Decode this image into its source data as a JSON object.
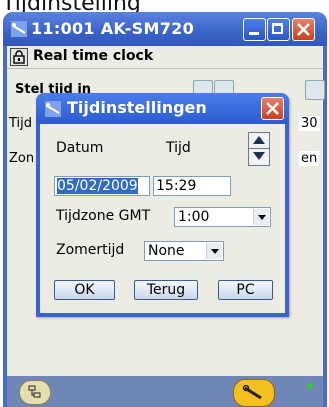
{
  "caption": "Tijdinstelling",
  "main_window": {
    "title": "11:001 AK-SM720",
    "section_title": "Real time clock",
    "background_labels": {
      "row1": "Stel tijd in",
      "row2": "Tijd",
      "row3": "Zon",
      "value_right1": "30",
      "value_right2": "en"
    }
  },
  "dialog": {
    "title": "Tijdinstellingen",
    "header_datum": "Datum",
    "header_tijd": "Tijd",
    "date_value": "05/02/2009",
    "time_value": "15:29",
    "timezone_label": "Tijdzone GMT",
    "timezone_value": "1:00",
    "dst_label": "Zomertijd",
    "dst_value": "None",
    "buttons": {
      "ok": "OK",
      "back": "Terug",
      "pc": "PC"
    }
  },
  "colors": {
    "titlebar": "#3a63c8",
    "window_body": "#ecebe4",
    "selection": "#316ac5",
    "close_red": "#c84022"
  },
  "icons": [
    "app-icon",
    "minimize-icon",
    "maximize-icon",
    "close-icon",
    "lock-icon",
    "spin-up-icon",
    "spin-down-icon",
    "network-icon",
    "wrench-icon",
    "status-dot-icon"
  ]
}
